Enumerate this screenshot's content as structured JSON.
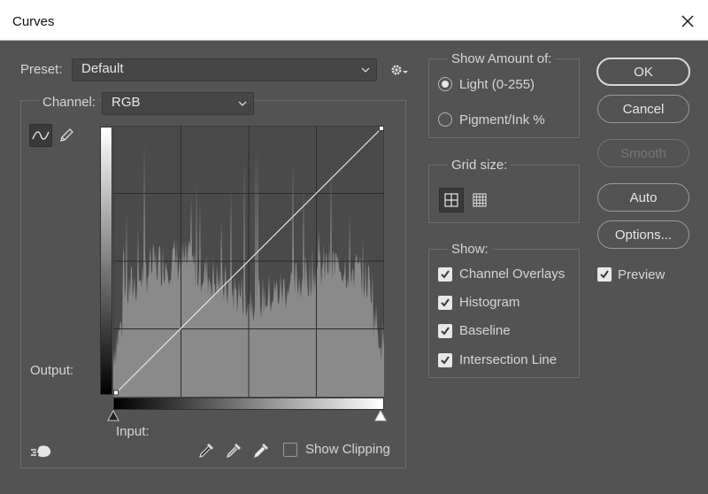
{
  "window": {
    "title": "Curves"
  },
  "preset": {
    "label": "Preset:",
    "value": "Default"
  },
  "channel": {
    "label": "Channel:",
    "value": "RGB"
  },
  "graph": {
    "output_label": "Output:",
    "input_label": "Input:",
    "show_clipping_label": "Show Clipping",
    "show_clipping_checked": false
  },
  "show_amount": {
    "title": "Show Amount of:",
    "options": [
      {
        "label": "Light  (0-255)",
        "selected": true
      },
      {
        "label": "Pigment/Ink %",
        "selected": false
      }
    ]
  },
  "grid_size": {
    "title": "Grid size:",
    "selected": "simple"
  },
  "show": {
    "title": "Show:",
    "items": [
      {
        "label": "Channel Overlays",
        "checked": true
      },
      {
        "label": "Histogram",
        "checked": true
      },
      {
        "label": "Baseline",
        "checked": true
      },
      {
        "label": "Intersection Line",
        "checked": true
      }
    ]
  },
  "buttons": {
    "ok": "OK",
    "cancel": "Cancel",
    "smooth": "Smooth",
    "auto": "Auto",
    "options": "Options..."
  },
  "preview": {
    "label": "Preview",
    "checked": true
  },
  "icons": {
    "close": "close-icon",
    "settings": "gear-icon",
    "curve_tool": "curve-point-icon",
    "pencil_tool": "pencil-icon",
    "eyedroppers": [
      "black-eyedropper-icon",
      "gray-eyedropper-icon",
      "white-eyedropper-icon"
    ],
    "hand": "on-image-adjust-icon"
  },
  "colors": {
    "background": "#535353",
    "graph_bg": "#4a4a4a",
    "histogram": "#8a8a8a",
    "curve": "#e6e6e6"
  }
}
